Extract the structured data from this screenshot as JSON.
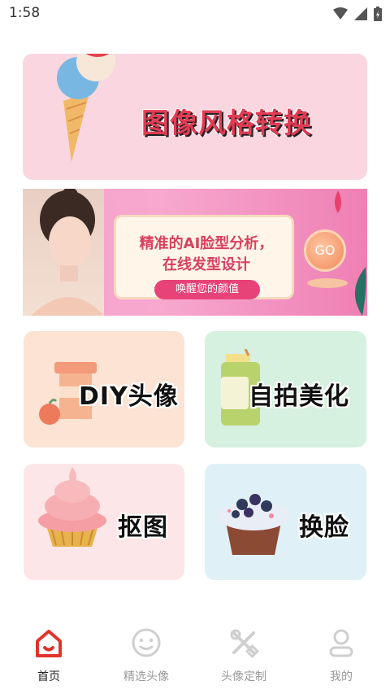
{
  "status_bar": {
    "time": "1:58"
  },
  "cards": {
    "style_transfer": {
      "title": "图像风格转换"
    },
    "banner": {
      "line1": "精准的AI脸型分析，",
      "line2": "在线发型设计",
      "pill": "唤醒您的颜值",
      "go": "GO"
    },
    "diy_avatar": {
      "title": "DIY头像"
    },
    "selfie_beauty": {
      "title": "自拍美化"
    },
    "cutout": {
      "title": "抠图"
    },
    "face_swap": {
      "title": "换脸"
    }
  },
  "bottom_nav": {
    "items": [
      {
        "label": "首页",
        "icon": "home-icon",
        "active": true
      },
      {
        "label": "精选头像",
        "icon": "smiley-face-icon",
        "active": false
      },
      {
        "label": "头像定制",
        "icon": "tools-icon",
        "active": false
      },
      {
        "label": "我的",
        "icon": "person-icon",
        "active": false
      }
    ]
  },
  "colors": {
    "accent": "#e23c55",
    "nav_active": "#e0342b",
    "nav_inactive": "#cfcfcf"
  }
}
